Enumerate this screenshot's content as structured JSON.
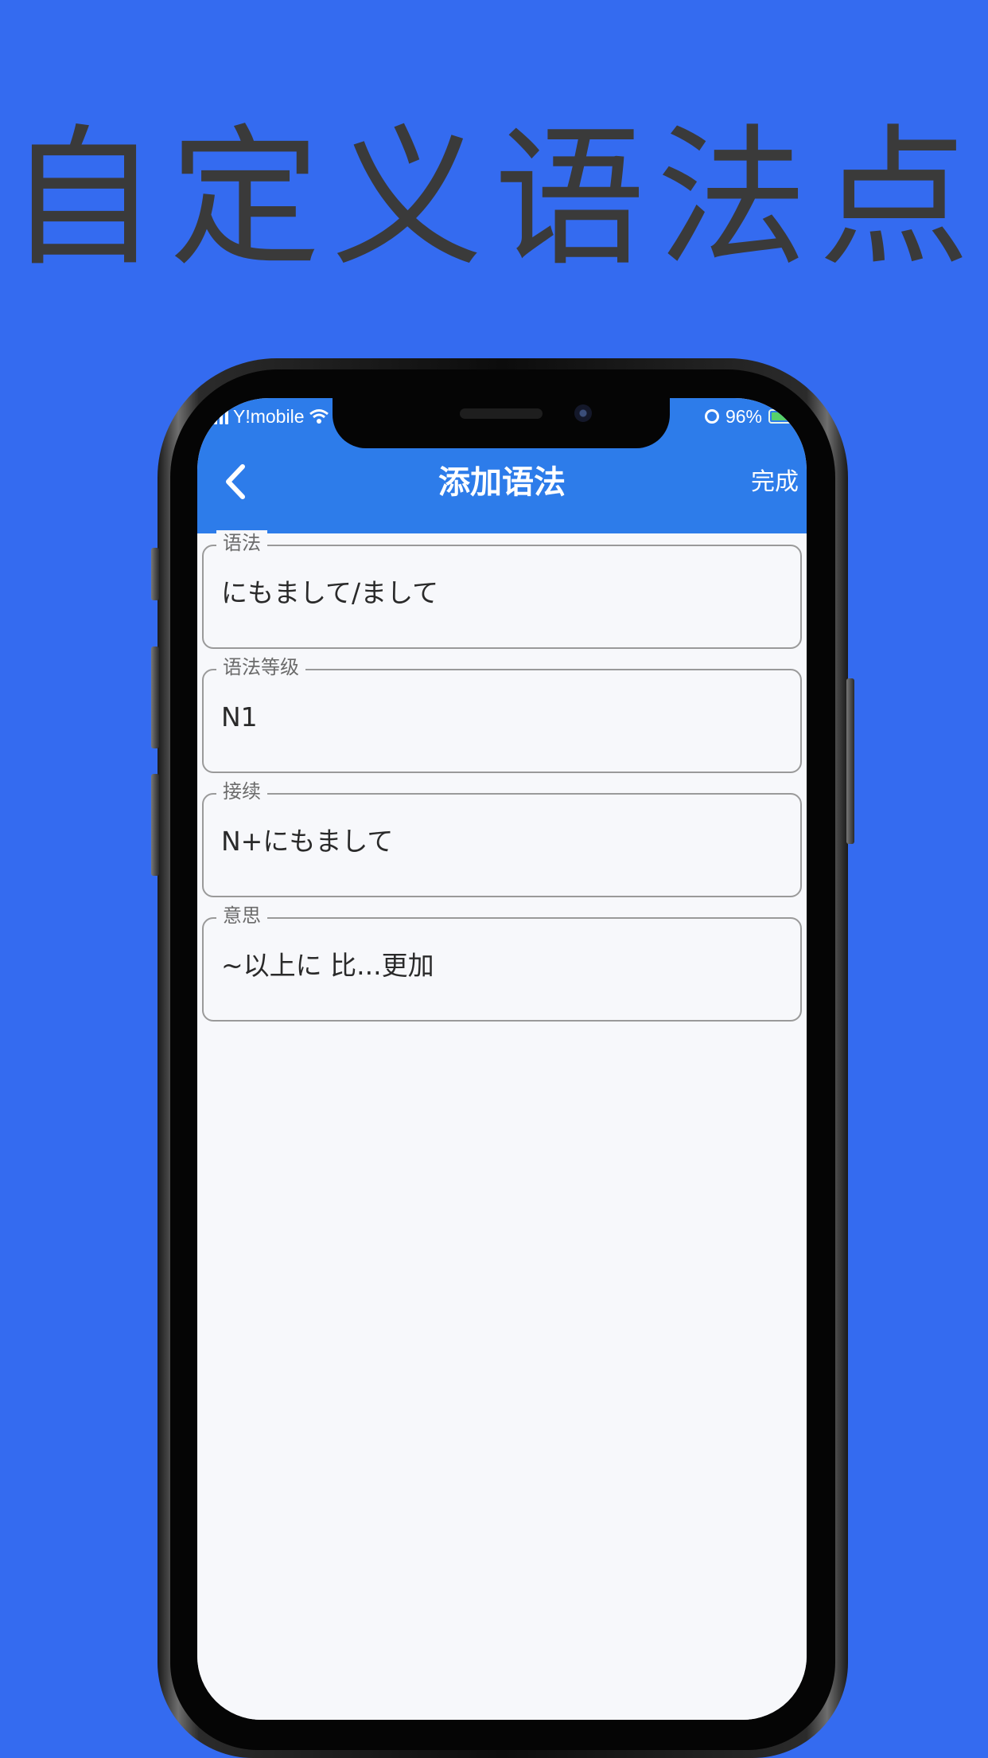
{
  "promo": {
    "title": "自定义语法点"
  },
  "status_bar": {
    "carrier": "Y!mobile",
    "battery": "96%",
    "icons": [
      "signal-icon",
      "wifi-icon",
      "alarm-icon",
      "battery-icon"
    ]
  },
  "nav": {
    "back_icon": "chevron-left-icon",
    "title": "添加语法",
    "done_label": "完成"
  },
  "form": {
    "fields": [
      {
        "label": "语法",
        "value": "にもまして/まして"
      },
      {
        "label": "语法等级",
        "value": "N1"
      },
      {
        "label": "接续",
        "value": "N+にもまして"
      },
      {
        "label": "意思",
        "value": "~以上に  比...更加"
      }
    ]
  },
  "colors": {
    "background": "#346BF0",
    "nav_bar": "#2D7CEA",
    "screen_bg": "#F7F8FB",
    "promo_text": "#3a3a3a"
  }
}
